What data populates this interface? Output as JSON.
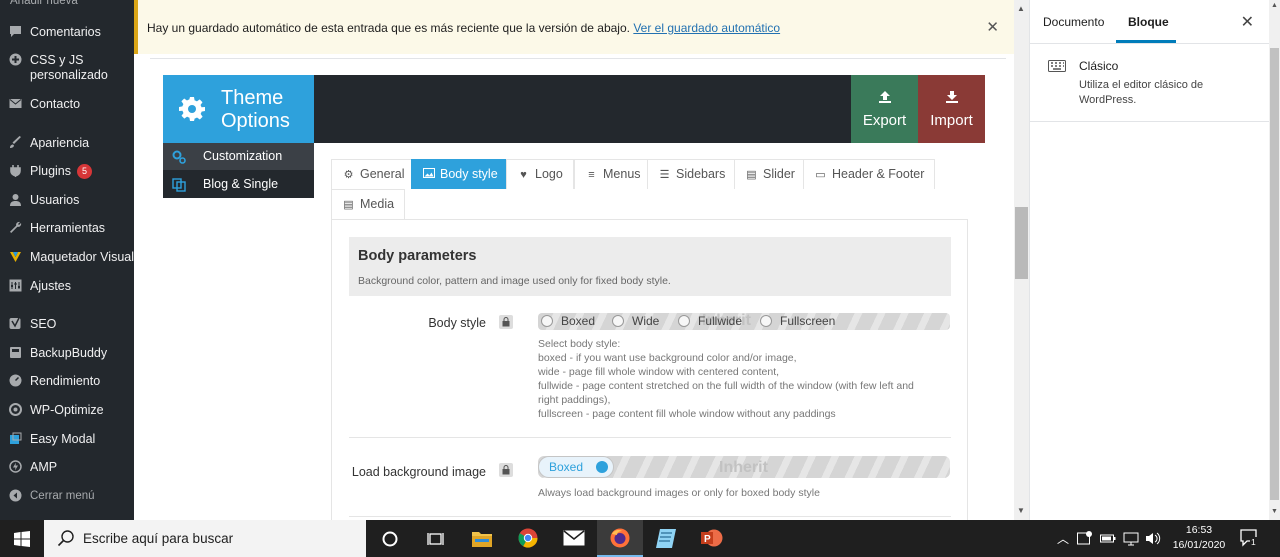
{
  "wp_sidebar": {
    "top_partial": "Añadir nueva",
    "items": [
      {
        "label": "Comentarios",
        "icon": "comment-icon"
      },
      {
        "label": "CSS y JS personalizado",
        "icon": "plus-circle-icon"
      },
      {
        "label": "Contacto",
        "icon": "mail-icon"
      },
      {
        "label": "Apariencia",
        "icon": "brush-icon"
      },
      {
        "label": "Plugins",
        "icon": "plug-icon",
        "badge": "5"
      },
      {
        "label": "Usuarios",
        "icon": "user-icon"
      },
      {
        "label": "Herramientas",
        "icon": "wrench-icon"
      },
      {
        "label": "Maquetador Visual",
        "icon": "visual-builder-icon"
      },
      {
        "label": "Ajustes",
        "icon": "settings-icon"
      },
      {
        "label": "SEO",
        "icon": "seo-icon"
      },
      {
        "label": "BackupBuddy",
        "icon": "backup-icon"
      },
      {
        "label": "Rendimiento",
        "icon": "gauge-icon"
      },
      {
        "label": "WP-Optimize",
        "icon": "optimize-icon"
      },
      {
        "label": "Easy Modal",
        "icon": "modal-icon"
      },
      {
        "label": "AMP",
        "icon": "amp-icon"
      }
    ],
    "collapse_label": "Cerrar menú"
  },
  "notice": {
    "text": "Hay un guardado automático de esta entrada que es más reciente que la versión de abajo.",
    "link": "Ver el guardado automático"
  },
  "theme_options": {
    "title_line1": "Theme",
    "title_line2": "Options",
    "export_label": "Export",
    "import_label": "Import",
    "nav": [
      {
        "label": "Customization",
        "icon": "cogs-icon"
      },
      {
        "label": "Blog & Single",
        "icon": "copy-icon"
      }
    ],
    "tabs": [
      {
        "label": "General",
        "icon": "gear-icon"
      },
      {
        "label": "Body style",
        "icon": "image-icon",
        "active": true
      },
      {
        "label": "Logo",
        "icon": "heart-icon"
      },
      {
        "label": "Menus",
        "icon": "list-icon"
      },
      {
        "label": "Sidebars",
        "icon": "sidebar-icon"
      },
      {
        "label": "Slider",
        "icon": "slider-icon"
      },
      {
        "label": "Header & Footer",
        "icon": "window-icon"
      },
      {
        "label": "Media",
        "icon": "media-icon"
      }
    ],
    "section": {
      "title": "Body parameters",
      "desc": "Background color, pattern and image used only for fixed body style."
    },
    "body_style": {
      "label": "Body style",
      "options": [
        "Boxed",
        "Wide",
        "Fullwide",
        "Fullscreen"
      ],
      "inherit": "Inherit",
      "help": [
        "Select body style:",
        "boxed - if you want use background color and/or image,",
        "wide - page fill whole window with centered content,",
        "fullwide - page content stretched on the full width of the window (with few left and",
        "right paddings),",
        "fullscreen - page content fill whole window without any paddings"
      ]
    },
    "load_bg": {
      "label": "Load background image",
      "toggle_label": "Boxed",
      "inherit": "Inherit",
      "help": "Always load background images or only for boxed body style"
    }
  },
  "inspector": {
    "tab_document": "Documento",
    "tab_block": "Bloque",
    "block_title": "Clásico",
    "block_desc": "Utiliza el editor clásico de WordPress."
  },
  "taskbar": {
    "search_placeholder": "Escribe aquí para buscar",
    "time": "16:53",
    "date": "16/01/2020",
    "notification_count": "1"
  },
  "colors": {
    "wp_sidebar_bg": "#23282d",
    "theme_blue": "#2ea1dc",
    "export_green": "#3a7a5a",
    "import_red": "#8a3a36",
    "notice_bg": "#fcf9e8",
    "wp_link_blue": "#2271b1"
  }
}
